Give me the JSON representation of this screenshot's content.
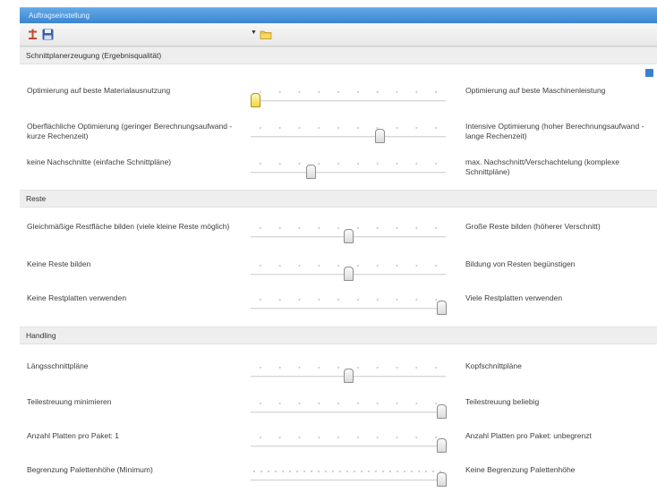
{
  "window": {
    "title": "Auftragseinstellung"
  },
  "toolbar": {
    "selected_value": ""
  },
  "colors": {
    "titlebar": "#3b86d1",
    "thumb_active": "#f2d93b",
    "section_bg": "#eeeeee"
  },
  "sections": [
    {
      "title": "Schnittplanerzeugung (Ergebnisqualität)"
    },
    {
      "title": "Reste"
    },
    {
      "title": "Handling"
    }
  ],
  "sliders": [
    {
      "left": "Optimierung auf beste Materialausnutzung",
      "right": "Optimierung auf beste Maschinenleistung",
      "value": 0.0
    },
    {
      "left": "Oberflächliche Optimierung (geringer Berechnungsaufwand - kurze Rechenzeit)",
      "right": "Intensive Optimierung (hoher Berechnungsaufwand - lange Rechenzeit)",
      "value": 0.67
    },
    {
      "left": "keine Nachschnitte (einfache Schnittpläne)",
      "right": "max. Nachschnitt/Verschachtelung (komplexe Schnittpläne)",
      "value": 0.3
    },
    {
      "left": "Gleichmäßige Restfläche bilden (viele kleine Reste möglich)",
      "right": "Große Reste bilden (höherer Verschnitt)",
      "value": 0.5
    },
    {
      "left": "Keine Reste bilden",
      "right": "Bildung von Resten begünstigen",
      "value": 0.5
    },
    {
      "left": "Keine Restplatten verwenden",
      "right": "Viele Restplatten verwenden",
      "value": 1.0
    },
    {
      "left": "Längsschnittpläne",
      "right": "Kopfschnittpläne",
      "value": 0.5
    },
    {
      "left": "Teilestreuung minimieren",
      "right": "Teilestreuung beliebig",
      "value": 1.0
    },
    {
      "left": "Anzahl Platten pro Paket: 1",
      "right": "Anzahl Platten pro Paket: unbegrenzt",
      "value": 1.0
    },
    {
      "left": "Begrenzung Palettenhöhe (Minimum)",
      "right": "Keine Begrenzung Palettenhöhe",
      "value": 1.0
    }
  ]
}
